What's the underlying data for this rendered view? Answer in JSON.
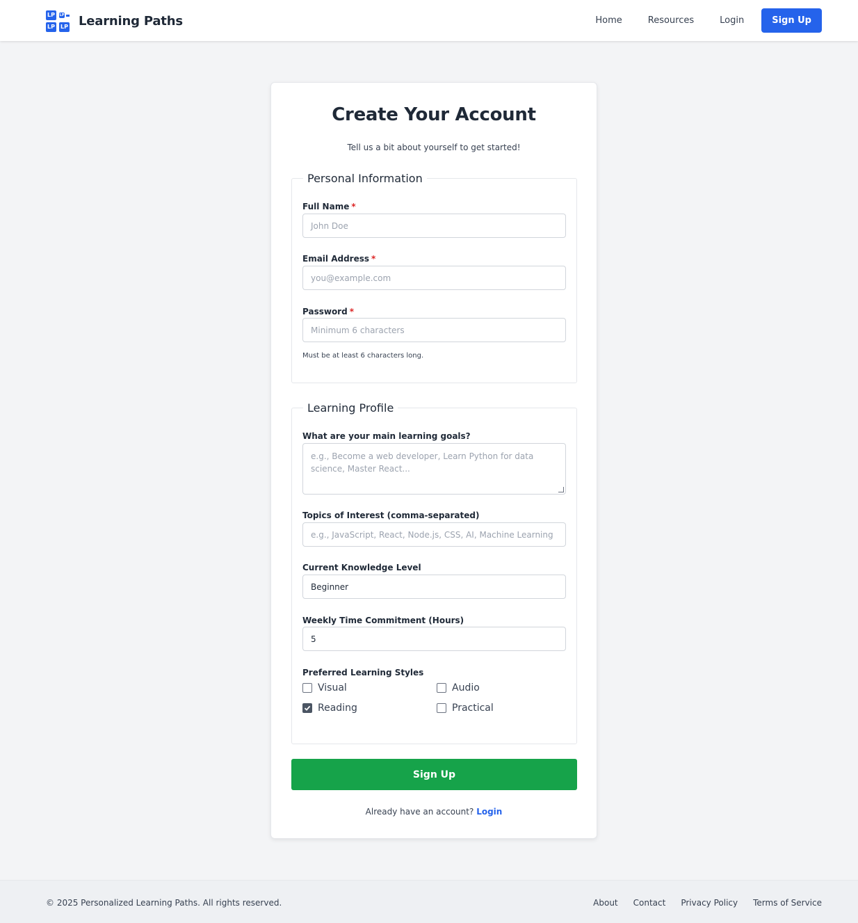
{
  "header": {
    "logo_text": "LP",
    "brand": "Learning Paths",
    "nav": [
      "Home",
      "Resources",
      "Login"
    ],
    "signup": "Sign Up"
  },
  "form": {
    "title": "Create Your Account",
    "subtitle": "Tell us a bit about yourself to get started!",
    "personal": {
      "legend": "Personal Information",
      "full_name": {
        "label": "Full Name",
        "required": "*",
        "placeholder": "John Doe"
      },
      "email": {
        "label": "Email Address",
        "required": "*",
        "placeholder": "you@example.com"
      },
      "password": {
        "label": "Password",
        "required": "*",
        "placeholder": "Minimum 6 characters",
        "hint": "Must be at least 6 characters long."
      }
    },
    "learning": {
      "legend": "Learning Profile",
      "goals": {
        "label": "What are your main learning goals?",
        "placeholder": "e.g., Become a web developer, Learn Python for data science, Master React..."
      },
      "topics": {
        "label": "Topics of Interest (comma-separated)",
        "placeholder": "e.g., JavaScript, React, Node.js, CSS, AI, Machine Learning"
      },
      "level": {
        "label": "Current Knowledge Level",
        "value": "Beginner"
      },
      "time": {
        "label": "Weekly Time Commitment (Hours)",
        "value": "5"
      },
      "styles": {
        "label": "Preferred Learning Styles",
        "options": [
          {
            "label": "Visual",
            "checked": false
          },
          {
            "label": "Audio",
            "checked": false
          },
          {
            "label": "Reading",
            "checked": true
          },
          {
            "label": "Practical",
            "checked": false
          }
        ]
      }
    },
    "submit": "Sign Up",
    "have_account": "Already have an account?",
    "login_link": "Login"
  },
  "footer": {
    "copyright": "© 2025 Personalized Learning Paths. All rights reserved.",
    "links": [
      "About",
      "Contact",
      "Privacy Policy",
      "Terms of Service"
    ]
  },
  "colors": {
    "primary": "#2563eb",
    "success": "#16a34a",
    "required": "#dc2626",
    "background": "#f3f4f6"
  }
}
